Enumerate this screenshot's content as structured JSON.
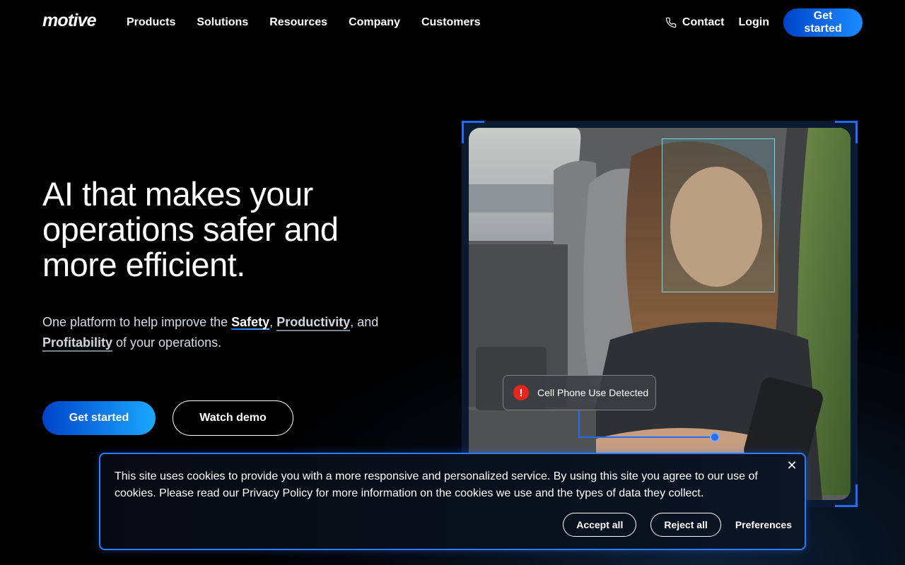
{
  "nav": {
    "logo": "motive",
    "links": [
      "Products",
      "Solutions",
      "Resources",
      "Company",
      "Customers"
    ],
    "contact": "Contact",
    "login": "Login",
    "cta": "Get started"
  },
  "hero": {
    "title": "AI that makes your operations safer and more efficient.",
    "sub_prefix": "One platform to help improve the ",
    "kw_safety": "Safety",
    "comma1": ",",
    "kw_productivity": "Productivity",
    "sub_and": ", and",
    "kw_profitability": "Profitability",
    "sub_suffix": " of your operations.",
    "primary_btn": "Get started",
    "secondary_btn": "Watch demo"
  },
  "video": {
    "alert_text": "Cell Phone Use Detected",
    "alert_icon": "exclamation-icon"
  },
  "cookie": {
    "text": "This site uses cookies to provide you with a more responsive and personalized service. By using this site you agree to our use of cookies. Please read our Privacy Policy for more information on the cookies we use and the types of data they collect.",
    "close": "✕",
    "accept": "Accept all",
    "reject": "Reject all",
    "preferences": "Preferences"
  },
  "colors": {
    "accent": "#1f6cff",
    "alert_red": "#e8251c",
    "face_box": "#6fe0e8"
  }
}
